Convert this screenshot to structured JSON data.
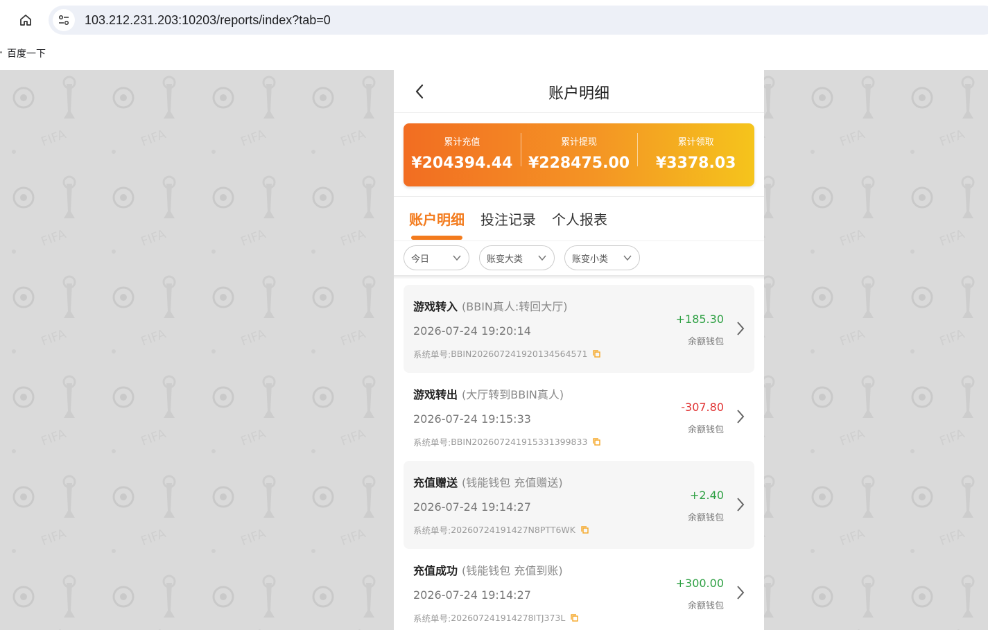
{
  "browser": {
    "url": "103.212.231.203:10203/reports/index?tab=0",
    "bookmark": "百度一下"
  },
  "header": {
    "title": "账户明细"
  },
  "summary": {
    "items": [
      {
        "label": "累计充值",
        "value": "¥204394.44"
      },
      {
        "label": "累计提现",
        "value": "¥228475.00"
      },
      {
        "label": "累计领取",
        "value": "¥3378.03"
      }
    ]
  },
  "tabs": [
    {
      "label": "账户明细",
      "active": true
    },
    {
      "label": "投注记录",
      "active": false
    },
    {
      "label": "个人报表",
      "active": false
    }
  ],
  "filters": [
    {
      "label": "今日"
    },
    {
      "label": "账变大类"
    },
    {
      "label": "账变小类"
    }
  ],
  "records": [
    {
      "type": "游戏转入",
      "detail": "(BBIN真人:转回大厅)",
      "time": "2026-07-24 19:20:14",
      "order_label": "系统单号:",
      "order": "BBIN20260724192013456457​1",
      "amount": "+185.30",
      "wallet": "余额钱包"
    },
    {
      "type": "游戏转出",
      "detail": "(大厅转到BBIN真人)",
      "time": "2026-07-24 19:15:33",
      "order_label": "系统单号:",
      "order": "BBIN20260724191533139983​3",
      "amount": "-307.80",
      "wallet": "余额钱包"
    },
    {
      "type": "充值赠送",
      "detail": "(钱能钱包 充值赠送)",
      "time": "2026-07-24 19:14:27",
      "order_label": "系统单号:",
      "order": "20260724191427N8PTT6WK",
      "amount": "+2.40",
      "wallet": "余额钱包"
    },
    {
      "type": "充值成功",
      "detail": "(钱能钱包 充值到账)",
      "time": "2026-07-24 19:14:27",
      "order_label": "系统单号:",
      "order": "202607241914278ITJ373L",
      "amount": "+300.00",
      "wallet": "余额钱包"
    }
  ],
  "colors": {
    "accent": "#f37b1d",
    "positive": "#2ea043",
    "negative": "#e03232"
  }
}
